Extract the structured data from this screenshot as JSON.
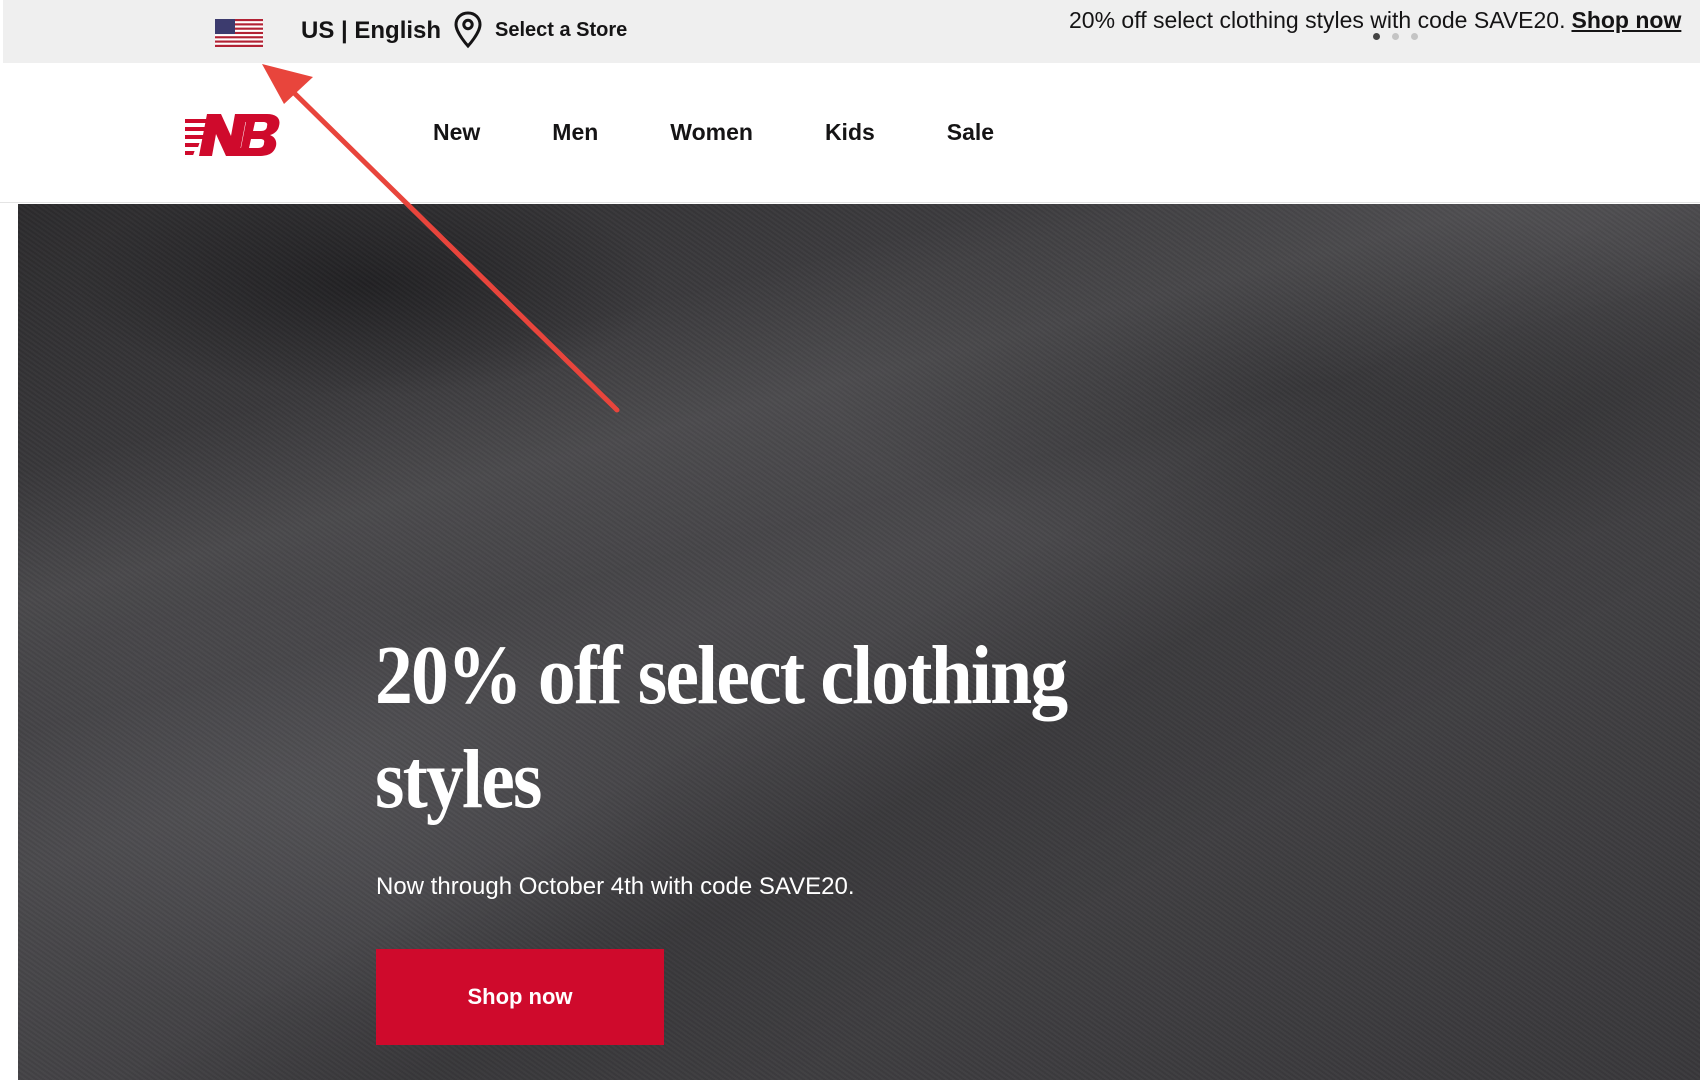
{
  "utility_bar": {
    "locale": "US | English",
    "store_label": "Select a Store",
    "promo_text": "20% off select clothing styles with code SAVE20.",
    "promo_link": "Shop now",
    "carousel_dots": 3,
    "active_dot": 1,
    "flag_icon": "us-flag-icon",
    "store_icon": "location-pin-icon"
  },
  "nav": {
    "logo": "new-balance-logo",
    "items": [
      {
        "label": "New"
      },
      {
        "label": "Men"
      },
      {
        "label": "Women"
      },
      {
        "label": "Kids"
      },
      {
        "label": "Sale"
      }
    ]
  },
  "hero": {
    "title": "20% off select clothing styles",
    "subtitle": "Now through October 4th with code SAVE20.",
    "cta_label": "Shop now"
  },
  "colors": {
    "brand_red": "#cf0a2c",
    "util_bg": "#efefef",
    "annotation_arrow": "#e8453c"
  }
}
